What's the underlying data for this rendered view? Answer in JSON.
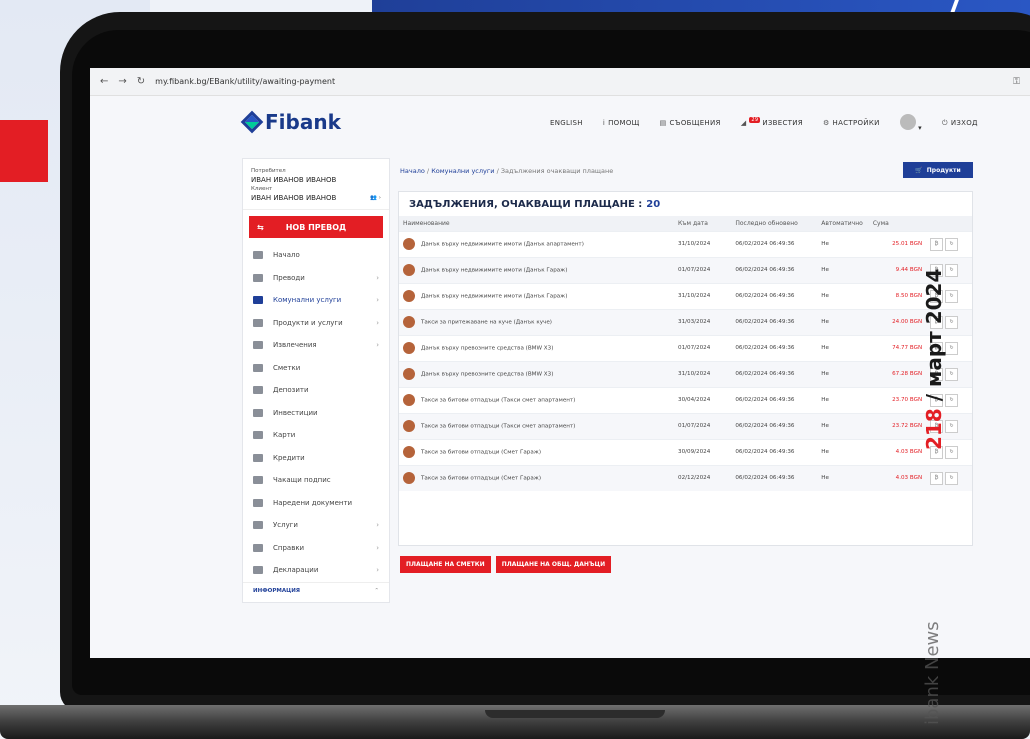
{
  "browser": {
    "url": "my.fibank.bg/EBank/utility/awaiting-payment"
  },
  "header": {
    "logo": "Fibank",
    "nav": [
      {
        "label": "ENGLISH"
      },
      {
        "label": "ПОМОЩ"
      },
      {
        "label": "СЪОБЩЕНИЯ"
      },
      {
        "label": "ИЗВЕСТИЯ",
        "badge": "29"
      },
      {
        "label": "НАСТРОЙКИ"
      },
      {
        "label": "ИЗХОД"
      }
    ]
  },
  "user": {
    "user_label": "Потребител",
    "user_name": "ИВАН ИВАНОВ ИВАНОВ",
    "client_label": "Клиент",
    "client_name": "ИВАН ИВАНОВ ИВАНОВ"
  },
  "sidebar": {
    "new_transfer": "НОВ ПРЕВОД",
    "items": [
      {
        "label": "Начало",
        "arrow": ""
      },
      {
        "label": "Преводи",
        "arrow": "›"
      },
      {
        "label": "Комунални услуги",
        "arrow": "›"
      },
      {
        "label": "Продукти и услуги",
        "arrow": "›"
      },
      {
        "label": "Извлечения",
        "arrow": "›"
      },
      {
        "label": "Сметки",
        "arrow": ""
      },
      {
        "label": "Депозити",
        "arrow": ""
      },
      {
        "label": "Инвестиции",
        "arrow": ""
      },
      {
        "label": "Карти",
        "arrow": ""
      },
      {
        "label": "Кредити",
        "arrow": ""
      },
      {
        "label": "Чакащи подпис",
        "arrow": ""
      },
      {
        "label": "Наредени документи",
        "arrow": ""
      },
      {
        "label": "Услуги",
        "arrow": "›"
      },
      {
        "label": "Справки",
        "arrow": "›"
      },
      {
        "label": "Декларации",
        "arrow": "›"
      }
    ],
    "info": "ИНФОРМАЦИЯ"
  },
  "breadcrumb": {
    "home": "Начало",
    "sep": "/",
    "section": "Комунални услуги",
    "current": "Задължения очакващи плащане"
  },
  "products_button": "Продукти",
  "panel": {
    "title": "ЗАДЪЛЖЕНИЯ, ОЧАКВАЩИ ПЛАЩАНЕ :",
    "count": "20",
    "columns": [
      "Наименование",
      "Към дата",
      "Последно обновено",
      "Автоматично",
      "Сума"
    ],
    "rows": [
      {
        "name": "Данък върху недвижимите имоти (Данък апартамент)",
        "date": "31/10/2024",
        "updated": "06/02/2024 06:49:36",
        "auto": "Не",
        "amount": "25.01 BGN"
      },
      {
        "name": "Данък върху недвижимите имоти (Данък Гараж)",
        "date": "01/07/2024",
        "updated": "06/02/2024 06:49:36",
        "auto": "Не",
        "amount": "9.44 BGN"
      },
      {
        "name": "Данък върху недвижимите имоти (Данък Гараж)",
        "date": "31/10/2024",
        "updated": "06/02/2024 06:49:36",
        "auto": "Не",
        "amount": "8.50 BGN"
      },
      {
        "name": "Такси за притежаване на куче (Данък куче)",
        "date": "31/03/2024",
        "updated": "06/02/2024 06:49:36",
        "auto": "Не",
        "amount": "24.00 BGN"
      },
      {
        "name": "Данък върху превозните средства (BMW X3)",
        "date": "01/07/2024",
        "updated": "06/02/2024 06:49:36",
        "auto": "Не",
        "amount": "74.77 BGN"
      },
      {
        "name": "Данък върху превозните средства (BMW X3)",
        "date": "31/10/2024",
        "updated": "06/02/2024 06:49:36",
        "auto": "Не",
        "amount": "67.28 BGN"
      },
      {
        "name": "Такси за битови отпадъци (Такси смет апартамент)",
        "date": "30/04/2024",
        "updated": "06/02/2024 06:49:36",
        "auto": "Не",
        "amount": "23.70 BGN"
      },
      {
        "name": "Такси за битови отпадъци (Такси смет апартамент)",
        "date": "01/07/2024",
        "updated": "06/02/2024 06:49:36",
        "auto": "Не",
        "amount": "23.72 BGN"
      },
      {
        "name": "Такси за битови отпадъци (Смет Гараж)",
        "date": "30/09/2024",
        "updated": "06/02/2024 06:49:36",
        "auto": "Не",
        "amount": "4.03 BGN"
      },
      {
        "name": "Такси за битови отпадъци (Смет Гараж)",
        "date": "02/12/2024",
        "updated": "06/02/2024 06:49:36",
        "auto": "Не",
        "amount": "4.03 BGN"
      }
    ]
  },
  "buttons": {
    "pay_bills": "ПЛАЩАНЕ НА СМЕТКИ",
    "pay_taxes": "ПЛАЩАНЕ НА ОБЩ. ДАНЪЦИ"
  },
  "magazine": {
    "issue_number": "218",
    "issue_date": " / март 2024",
    "news": "ibank News"
  }
}
